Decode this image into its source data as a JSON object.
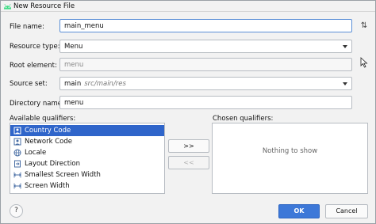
{
  "window": {
    "title": "New Resource File"
  },
  "form": {
    "file_name_label": "File name:",
    "file_name_value": "main_menu",
    "resource_type_label": "Resource type:",
    "resource_type_value": "Menu",
    "root_element_label": "Root element:",
    "root_element_placeholder": "menu",
    "source_set_label": "Source set:",
    "source_set_value": "main",
    "source_set_hint": "src/main/res",
    "directory_name_label": "Directory name:",
    "directory_name_value": "menu",
    "sort_icon": "⇅"
  },
  "qualifiers": {
    "available_label": "Available qualifiers:",
    "chosen_label": "Chosen qualifiers:",
    "available_items": [
      {
        "label": "Country Code",
        "icon": "country-code-icon",
        "selected": true
      },
      {
        "label": "Network Code",
        "icon": "network-code-icon",
        "selected": false
      },
      {
        "label": "Locale",
        "icon": "globe-icon",
        "selected": false
      },
      {
        "label": "Layout Direction",
        "icon": "layout-direction-icon",
        "selected": false
      },
      {
        "label": "Smallest Screen Width",
        "icon": "screen-width-icon",
        "selected": false
      },
      {
        "label": "Screen Width",
        "icon": "screen-width-icon",
        "selected": false
      }
    ],
    "add_button": ">>",
    "remove_button": "<<",
    "empty_text": "Nothing to show"
  },
  "footer": {
    "help_label": "?",
    "ok_label": "OK",
    "cancel_label": "Cancel"
  },
  "colors": {
    "accent": "#2f65ca",
    "focus_border": "#5b8fd7",
    "android_green": "#3ddc84"
  }
}
